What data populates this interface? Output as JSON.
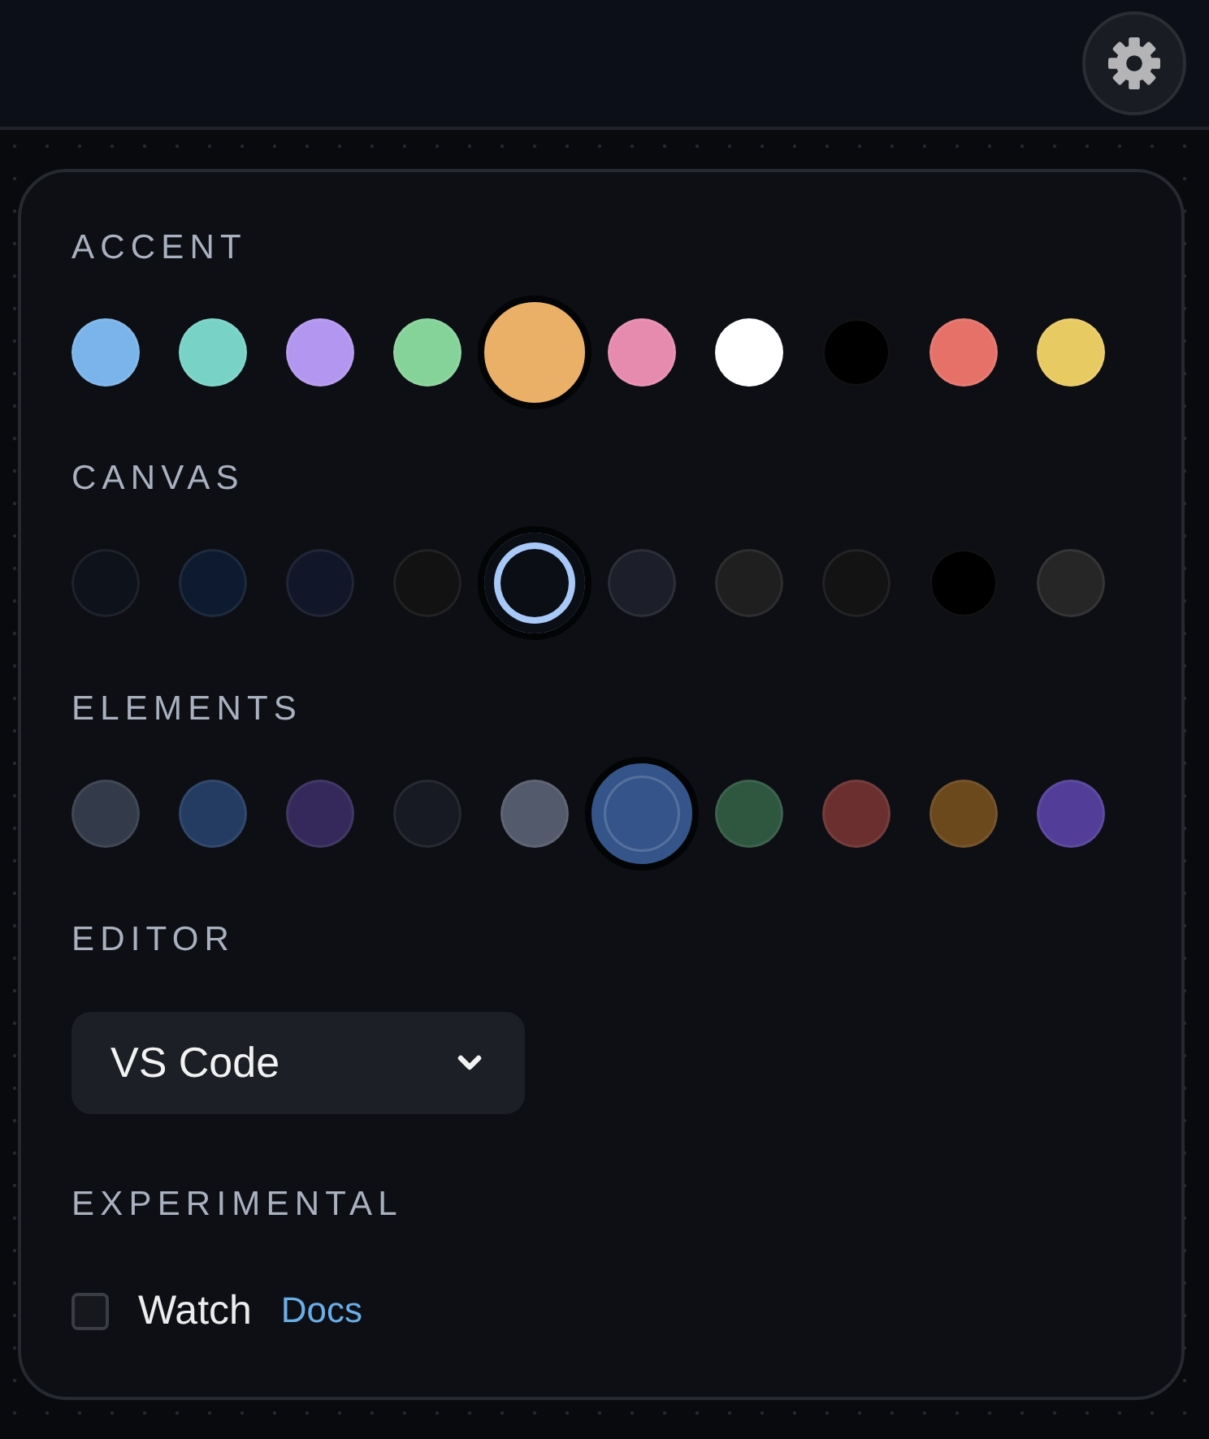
{
  "sections": [
    {
      "kind": "swatches",
      "title": "ACCENT",
      "swatches": [
        {
          "color": "#7ab4ea",
          "selected": false
        },
        {
          "color": "#78d2c6",
          "selected": false
        },
        {
          "color": "#b396ef",
          "selected": false
        },
        {
          "color": "#86d39a",
          "selected": false
        },
        {
          "color": "#ebb067",
          "selected": true
        },
        {
          "color": "#e78bae",
          "selected": false
        },
        {
          "color": "#ffffff",
          "selected": false
        },
        {
          "color": "#000000",
          "selected": false
        },
        {
          "color": "#e57169",
          "selected": false
        },
        {
          "color": "#e8ca62",
          "selected": false
        }
      ]
    },
    {
      "kind": "swatches",
      "title": "CANVAS",
      "swatches": [
        {
          "color": "#0e121b",
          "selected": false
        },
        {
          "color": "#0d1a30",
          "selected": false
        },
        {
          "color": "#111628",
          "selected": false
        },
        {
          "color": "#121212",
          "selected": false
        },
        {
          "color": "#0b0e15",
          "selected": true
        },
        {
          "color": "#1c1f29",
          "selected": false
        },
        {
          "color": "#1f1f1f",
          "selected": false
        },
        {
          "color": "#131313",
          "selected": false
        },
        {
          "color": "#000000",
          "selected": false
        },
        {
          "color": "#262626",
          "selected": false
        }
      ]
    },
    {
      "kind": "swatches",
      "title": "ELEMENTS",
      "swatches": [
        {
          "color": "#333b4a",
          "selected": false
        },
        {
          "color": "#243b62",
          "selected": false
        },
        {
          "color": "#34295a",
          "selected": false
        },
        {
          "color": "#171a22",
          "selected": false
        },
        {
          "color": "#535a6b",
          "selected": false
        },
        {
          "color": "#35558a",
          "selected": true
        },
        {
          "color": "#2f5740",
          "selected": false
        },
        {
          "color": "#6b2f2f",
          "selected": false
        },
        {
          "color": "#6c481d",
          "selected": false
        },
        {
          "color": "#523e98",
          "selected": false
        }
      ]
    },
    {
      "kind": "select",
      "title": "EDITOR",
      "value": "VS Code"
    },
    {
      "kind": "checks",
      "title": "EXPERIMENTAL",
      "items": [
        {
          "label": "Watch",
          "checked": false,
          "link": "Docs"
        }
      ]
    }
  ]
}
